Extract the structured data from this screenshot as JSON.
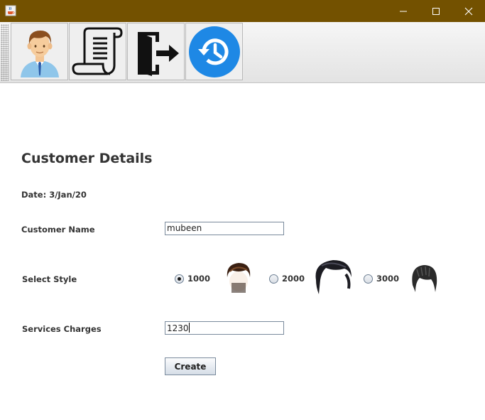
{
  "window": {
    "icon": "java-coffee-icon",
    "controls": [
      "minimize-icon",
      "maximize-icon",
      "close-icon"
    ],
    "titlebar_color": "#735100"
  },
  "toolbar": {
    "buttons": [
      {
        "name": "customer-button",
        "icon": "customer-avatar-icon"
      },
      {
        "name": "bill-button",
        "icon": "receipt-scroll-icon"
      },
      {
        "name": "logout-button",
        "icon": "exit-door-icon"
      },
      {
        "name": "history-button",
        "icon": "history-clock-icon",
        "color": "#1e88e5"
      }
    ]
  },
  "form": {
    "heading": "Customer Details",
    "date_label": "Date: 3/Jan/20",
    "customer_name_label": "Customer Name",
    "customer_name_value": "mubeen",
    "select_style_label": "Select Style",
    "styles": [
      {
        "label": "1000",
        "selected": true,
        "icon": "hairstyle-1-image"
      },
      {
        "label": "2000",
        "selected": false,
        "icon": "hairstyle-2-image"
      },
      {
        "label": "3000",
        "selected": false,
        "icon": "hairstyle-3-image"
      }
    ],
    "services_charges_label": "Services Charges",
    "services_charges_value": "1230",
    "create_label": "Create"
  }
}
